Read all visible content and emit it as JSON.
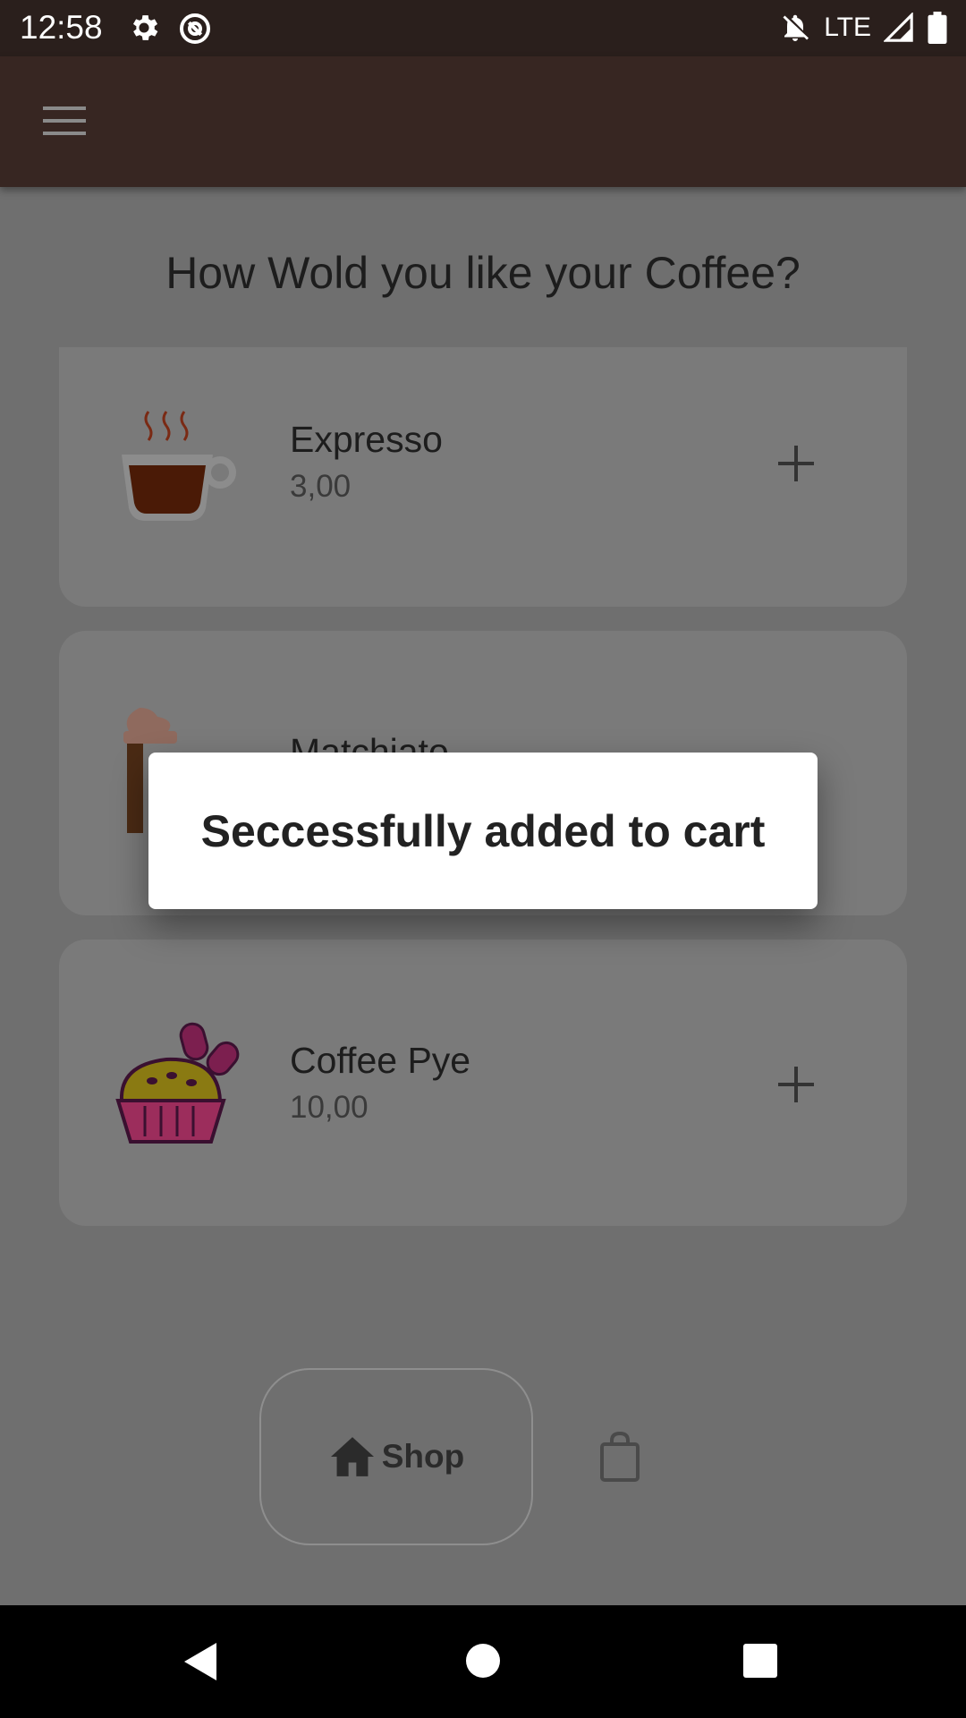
{
  "status_bar": {
    "time": "12:58",
    "network": "LTE",
    "icons": [
      "gear-icon",
      "at-sign-icon",
      "notifications-off-icon",
      "signal-icon",
      "battery-icon"
    ]
  },
  "app_bar": {
    "menu_icon": "menu-icon",
    "color": "#372622"
  },
  "main": {
    "heading": "How Wold you like your Coffee?",
    "products": [
      {
        "name": "Expresso",
        "price": "3,00",
        "icon": "coffee-cup-icon"
      },
      {
        "name": "Matchiato",
        "price": "",
        "icon": "iced-coffee-icon"
      },
      {
        "name": "Coffee Pye",
        "price": "10,00",
        "icon": "pie-icon"
      }
    ]
  },
  "bottom_nav": {
    "shop_label": "Shop",
    "shop_icon": "home-icon",
    "cart_icon": "shopping-bag-icon"
  },
  "dialog": {
    "message": "Seccessfully added to cart"
  },
  "colors": {
    "status_bar": "#2a1f1c",
    "app_bar": "#372622",
    "scrim_background": "#6f6f6f",
    "dialog": "#ffffff"
  }
}
